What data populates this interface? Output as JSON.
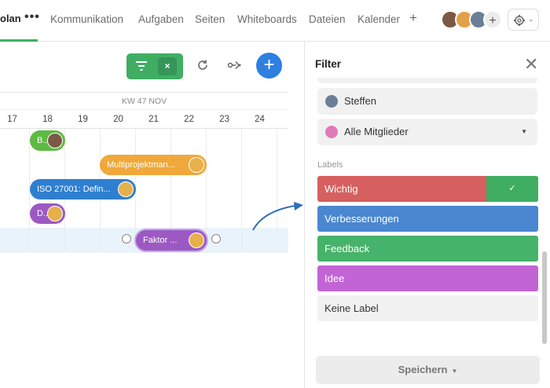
{
  "topbar": {
    "active_tab": "olan",
    "more": "•••",
    "tabs": [
      "Kommunikation",
      "Aufgaben",
      "Seiten",
      "Whiteboards",
      "Dateien",
      "Kalender"
    ],
    "add_tab": "+",
    "add_member": "+"
  },
  "toolbar": {
    "filter_clear": "×",
    "add": "+"
  },
  "timeline": {
    "week_label": "KW 47 NOV",
    "days": [
      "17",
      "18",
      "19",
      "20",
      "21",
      "22",
      "23",
      "24"
    ],
    "bars": [
      {
        "label": "B...",
        "color": "#5dba43"
      },
      {
        "label": "Multiprojektman...",
        "color": "#f0a83a"
      },
      {
        "label": "ISO 27001: Defin...",
        "color": "#2f7fd0"
      },
      {
        "label": "D...",
        "color": "#9c59c3"
      },
      {
        "label": "Faktor ...",
        "color": "#9c59c3"
      }
    ]
  },
  "filter_panel": {
    "title": "Filter",
    "close": "✕",
    "members": [
      {
        "name": "Steffen",
        "avatar_color": "#6a7f95"
      },
      {
        "name": "Alle Mitglieder",
        "avatar_color": "#e07ab8",
        "has_caret": true
      }
    ],
    "labels_heading": "Labels",
    "labels": [
      {
        "name": "Wichtig",
        "color": "#d6605f",
        "selected": true,
        "check": "✓"
      },
      {
        "name": "Verbesserungen",
        "color": "#4a87d0"
      },
      {
        "name": "Feedback",
        "color": "#46b36a"
      },
      {
        "name": "Idee",
        "color": "#c264d6"
      },
      {
        "name": "Keine Label",
        "color": "#f1f1f1"
      }
    ],
    "save_label": "Speichern"
  }
}
